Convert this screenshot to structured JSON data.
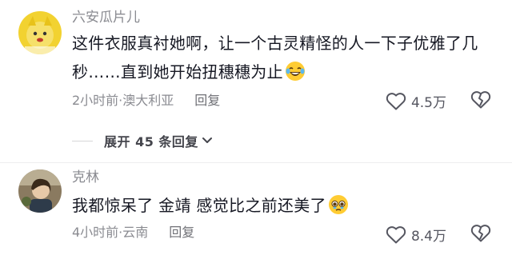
{
  "comments": [
    {
      "username": "六安瓜片儿",
      "text": "这件衣服真衬她啊，让一个古灵精怪的人一下子优雅了几秒……直到她开始扭穗穗为止",
      "emoji": "laughing-tears-emoji",
      "time_location": "2小时前·澳大利亚",
      "reply_label": "回复",
      "likes": "4.5万"
    },
    {
      "username": "克林",
      "text": "我都惊呆了 金靖 感觉比之前还美了",
      "emoji": "teary-pleading-emoji",
      "time_location": "4小时前·云南",
      "reply_label": "回复",
      "likes": "8.4万"
    }
  ],
  "expand_replies": {
    "label": "展开 45 条回复"
  },
  "icons": {
    "like": "heart-outline-icon",
    "dislike": "broken-heart-icon",
    "expand": "chevron-down-icon"
  }
}
